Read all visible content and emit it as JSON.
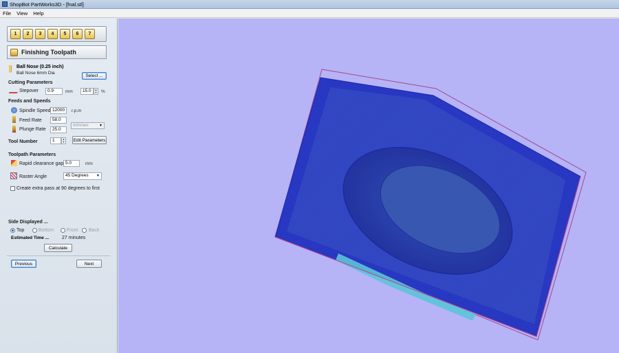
{
  "window": {
    "title": "ShopBot PartWorks3D - [fnal.stl]"
  },
  "menu": [
    "File",
    "View",
    "Help"
  ],
  "toolbar": {
    "buttons": [
      "1",
      "2",
      "3",
      "4",
      "5",
      "6",
      "7"
    ]
  },
  "panel": {
    "title": "Finishing Toolpath"
  },
  "tool": {
    "name": "Ball Nose (0.25 inch)",
    "desc": "Ball Nose 6mm Dia",
    "select_label": "Select ..."
  },
  "cutting": {
    "heading": "Cutting Parameters",
    "stepover_label": "Stepover",
    "stepover_value": "0.9",
    "stepover_unit": "mm",
    "stepover_percent": "15.0",
    "percent_symbol": "%"
  },
  "feeds": {
    "heading": "Feeds and Speeds",
    "spindle_label": "Spindle Speed",
    "spindle_value": "12000",
    "spindle_unit": "r.p.m",
    "feed_label": "Feed Rate",
    "feed_value": "58.0",
    "rate_unit": "mm/sec",
    "plunge_label": "Plunge Rate",
    "plunge_value": "25.0",
    "tool_number_label": "Tool Number",
    "tool_number_value": "1",
    "edit_params_label": "Edit Parameters"
  },
  "toolpath": {
    "heading": "Toolpath Parameters",
    "clearance_label": "Rapid clearance gap",
    "clearance_value": "5.0",
    "clearance_unit": "mm",
    "raster_label": "Raster Angle",
    "raster_value": "45 Degrees",
    "extra_pass_label": "Create extra pass at 90 degrees to first"
  },
  "side": {
    "heading": "Side Displayed ...",
    "options": [
      "Top",
      "Bottom",
      "Front",
      "Back"
    ],
    "selected": "Top",
    "estimated_label": "Estimated Time ...",
    "estimated_value": "27 minutes",
    "calculate_label": "Calculate"
  },
  "nav": {
    "previous_label": "Previous",
    "next_label": "Next"
  },
  "colors": {
    "viewport_bg": "#b6b3f7",
    "toolpath_blue": "#1f2fd1",
    "surface_blue": "#3e58b8",
    "cyan_region": "#5bc3d8"
  }
}
